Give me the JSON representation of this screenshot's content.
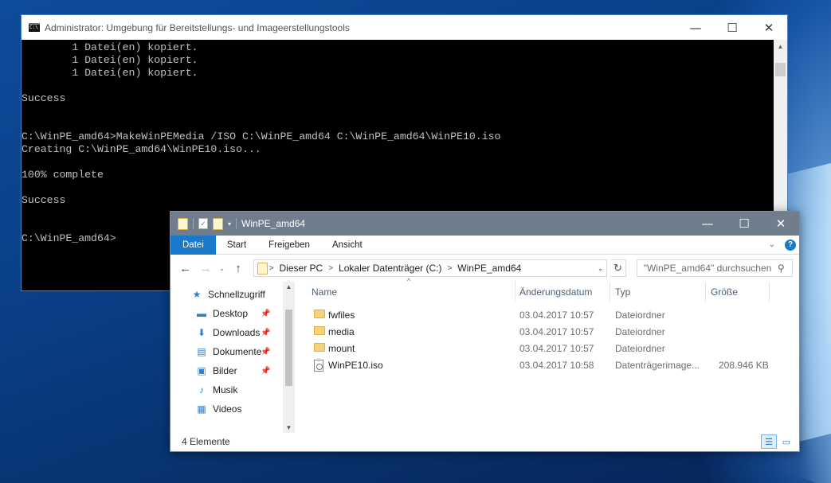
{
  "cmd": {
    "icon": "cmd-icon",
    "title": "Administrator: Umgebung für Bereitstellungs- und Imageerstellungstools",
    "lines": [
      "        1 Datei(en) kopiert.",
      "        1 Datei(en) kopiert.",
      "        1 Datei(en) kopiert.",
      "",
      "Success",
      "",
      "",
      "C:\\WinPE_amd64>MakeWinPEMedia /ISO C:\\WinPE_amd64 C:\\WinPE_amd64\\WinPE10.iso",
      "Creating C:\\WinPE_amd64\\WinPE10.iso...",
      "",
      "100% complete",
      "",
      "Success",
      "",
      "",
      "C:\\WinPE_amd64>"
    ],
    "buttons": {
      "minimize": "—",
      "maximize": "☐",
      "close": "✕"
    }
  },
  "explorer": {
    "title": "WinPE_amd64",
    "buttons": {
      "minimize": "—",
      "maximize": "☐",
      "close": "✕"
    },
    "ribbon": {
      "file_tab": "Datei",
      "tabs": [
        "Start",
        "Freigeben",
        "Ansicht"
      ],
      "expand": "⌄",
      "help": "?"
    },
    "nav_buttons": {
      "back": "←",
      "forward": "→",
      "recent": "⌄",
      "up": "↑"
    },
    "address": [
      "Dieser PC",
      "Lokaler Datenträger (C:)",
      "WinPE_amd64"
    ],
    "address_separator": ">",
    "address_dropdown": "⌄",
    "refresh": "↻",
    "search": {
      "placeholder": "\"WinPE_amd64\" durchsuchen",
      "icon": "⚲"
    },
    "nav_pane": [
      {
        "label": "Schnellzugriff",
        "icon": "star-icon",
        "glyph": "★",
        "pinned": false
      },
      {
        "label": "Desktop",
        "icon": "desktop-icon",
        "glyph": "▬",
        "pinned": true
      },
      {
        "label": "Downloads",
        "icon": "download-icon",
        "glyph": "⬇",
        "pinned": true
      },
      {
        "label": "Dokumente",
        "icon": "document-icon",
        "glyph": "▤",
        "pinned": true
      },
      {
        "label": "Bilder",
        "icon": "pictures-icon",
        "glyph": "▣",
        "pinned": true
      },
      {
        "label": "Musik",
        "icon": "music-icon",
        "glyph": "♪",
        "pinned": false
      },
      {
        "label": "Videos",
        "icon": "videos-icon",
        "glyph": "▦",
        "pinned": false
      }
    ],
    "pin_glyph": "📌",
    "columns": {
      "name": "Name",
      "date": "Änderungsdatum",
      "type": "Typ",
      "size": "Größe"
    },
    "sort_glyph": "^",
    "files": [
      {
        "name": "fwfiles",
        "date": "03.04.2017 10:57",
        "type": "Dateiordner",
        "size": "",
        "kind": "folder"
      },
      {
        "name": "media",
        "date": "03.04.2017 10:57",
        "type": "Dateiordner",
        "size": "",
        "kind": "folder"
      },
      {
        "name": "mount",
        "date": "03.04.2017 10:57",
        "type": "Dateiordner",
        "size": "",
        "kind": "folder"
      },
      {
        "name": "WinPE10.iso",
        "date": "03.04.2017 10:58",
        "type": "Datenträgerimage...",
        "size": "208.946 KB",
        "kind": "file"
      }
    ],
    "status": "4 Elemente"
  },
  "colors": {
    "console_bg": "#000000",
    "console_text": "#c0c0c0",
    "explorer_title_bg": "#6f7d8c",
    "file_tab_bg": "#1979ca",
    "folder_yellow": "#f3d47c",
    "column_header_text": "#4c607a"
  }
}
